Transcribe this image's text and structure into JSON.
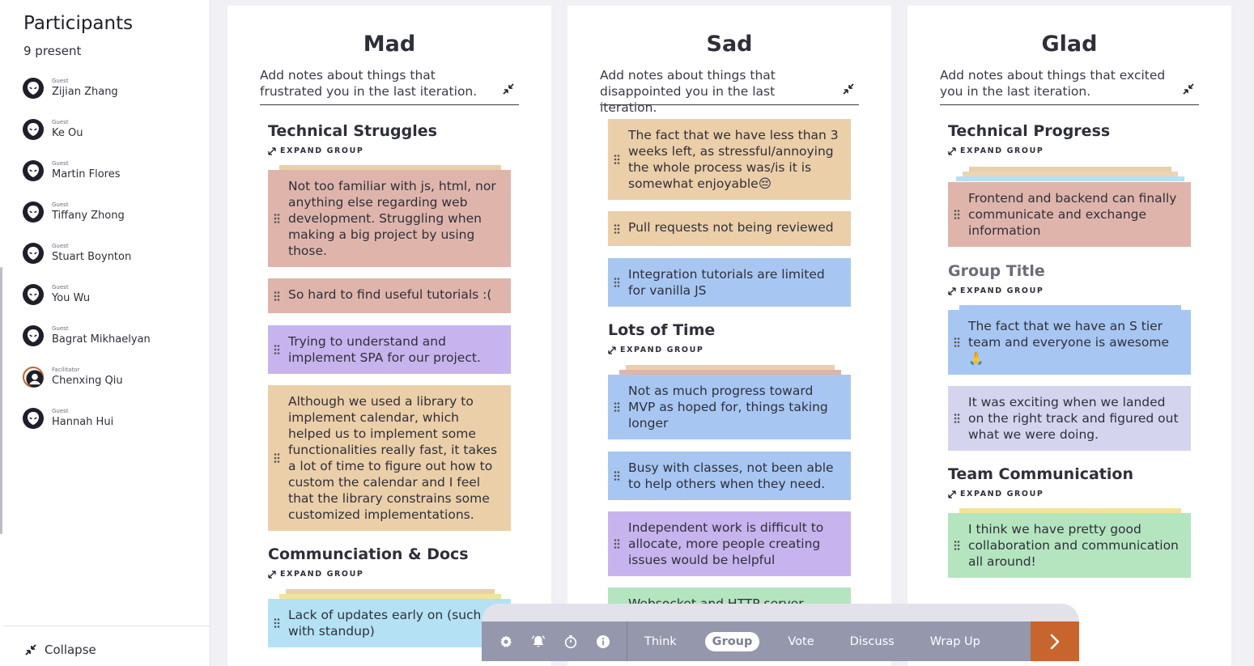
{
  "sidebar": {
    "title": "Participants",
    "present": "9 present",
    "participants": [
      {
        "role": "Guest",
        "name": "Zijian Zhang"
      },
      {
        "role": "Guest",
        "name": "Ke Ou"
      },
      {
        "role": "Guest",
        "name": "Martin Flores"
      },
      {
        "role": "Guest",
        "name": "Tiffany Zhong"
      },
      {
        "role": "Guest",
        "name": "Stuart Boynton"
      },
      {
        "role": "Guest",
        "name": "You Wu"
      },
      {
        "role": "Guest",
        "name": "Bagrat Mikhaelyan"
      },
      {
        "role": "Facilitator",
        "name": "Chenxing Qiu"
      },
      {
        "role": "Guest",
        "name": "Hannah Hui"
      }
    ],
    "collapse_label": "Collapse"
  },
  "expand_label": "EXPAND GROUP",
  "columns": {
    "mad": {
      "title": "Mad",
      "prompt": "Add notes about things that frustrated you in the last iteration.",
      "groups": [
        {
          "title": "Technical Struggles"
        },
        {
          "title": "Communciation & Docs"
        }
      ],
      "cards": [
        "Not too familiar with js, html, nor anything else regarding web development. Struggling when making a big project by using those.",
        "So hard to find useful tutorials :(",
        "Trying to understand and implement SPA for our project.",
        "Although we used a library to implement calendar, which helped us to implement some functionalities really fast, it takes a lot of time to figure out how to custom the calendar and I feel that the library constrains some customized implementations.",
        "Lack of updates early on (such as with standup)"
      ]
    },
    "sad": {
      "title": "Sad",
      "prompt": "Add notes about things that disappointed you in the last iteration.",
      "groups": [
        {
          "title": "Lots of Time"
        }
      ],
      "cards": [
        "The fact that we have less than 3 weeks left, as stressful/annoying the whole process was/is it is somewhat enjoyable😔",
        "Pull requests not being reviewed",
        "Integration tutorials are limited for vanilla JS",
        "Not as much progress toward MVP as hoped for, things taking longer",
        "Busy with classes, not been able to help others when they need.",
        "Independent work is difficult to allocate, more people creating issues would be helpful",
        "Websocket and HTTP server"
      ]
    },
    "glad": {
      "title": "Glad",
      "prompt": "Add notes about things that excited you in the last iteration.",
      "groups": [
        {
          "title": "Technical Progress"
        },
        {
          "title": "Group Title"
        },
        {
          "title": "Team Communication"
        }
      ],
      "cards": [
        "Frontend and backend can finally communicate and exchange information",
        "The fact that we have an S tier team and everyone is awesome 🙏",
        "It was exciting when we landed on the right track and figured out what we were doing.",
        "I think we have pretty good collaboration and communication all around!"
      ]
    }
  },
  "toolbar": {
    "icons": [
      "settings-icon",
      "bell-icon",
      "timer-icon",
      "info-icon"
    ],
    "phases": [
      "Think",
      "Group",
      "Vote",
      "Discuss",
      "Wrap Up"
    ],
    "active_phase": "Group"
  },
  "colors": {
    "accent": "#c8652e",
    "toolbar": "#9597ad",
    "pink": "#dfb5ab",
    "orange": "#ebcfa9",
    "purple": "#c7b4ee",
    "blue": "#a7c7f2",
    "lavender": "#d4d4ef",
    "green": "#b4e5bf",
    "cyan": "#b4e2f4"
  }
}
